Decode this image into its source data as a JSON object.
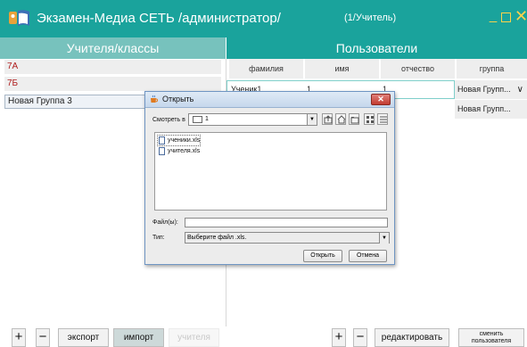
{
  "app": {
    "title": "Экзамен-Медиа СЕТЬ /администратор/",
    "user_label": "(1/Учитель)",
    "accent": "#1aa39c",
    "accent_light": "#77c2bd",
    "window_buttons": [
      "minimize-icon",
      "maximize-icon",
      "close-icon"
    ]
  },
  "left_panel": {
    "header": "Учителя/классы",
    "classes": [
      {
        "label": "7А",
        "style": "red"
      },
      {
        "label": "7Б",
        "style": "red"
      },
      {
        "label": "Новая Группа 3",
        "style": "selected"
      }
    ]
  },
  "right_panel": {
    "header": "Пользователи",
    "columns": [
      "фамилия",
      "имя",
      "отчество",
      "группа"
    ],
    "rows": [
      {
        "lastname": "Ученик1",
        "firstname": "1",
        "middlename": "1",
        "group": "Новая Групп..."
      },
      {
        "lastname": "",
        "firstname": "",
        "middlename": "",
        "group": "Новая Групп..."
      }
    ]
  },
  "toolbar": {
    "add": "+",
    "remove": "−",
    "export": "экспорт",
    "import": "импорт",
    "teacher": "учителя",
    "add_user": "+",
    "remove_user": "−",
    "edit": "редактировать",
    "change_user_line1": "сменить",
    "change_user_line2": "пользователя"
  },
  "dialog": {
    "title": "Открыть",
    "look_in_label": "Смотреть в",
    "look_in_value": "1",
    "files": [
      "ученики.xls",
      "учителя.xls"
    ],
    "selected_file": "ученики.xls",
    "filename_label": "Файл(ы):",
    "filename_value": "",
    "type_label": "Тип:",
    "type_value": "Выберите файл .xls.",
    "open_button": "Открыть",
    "cancel_button": "Отмена",
    "toolbar_icons": [
      "up-folder-icon",
      "home-icon",
      "new-folder-icon",
      "list-view-icon",
      "details-view-icon"
    ]
  }
}
